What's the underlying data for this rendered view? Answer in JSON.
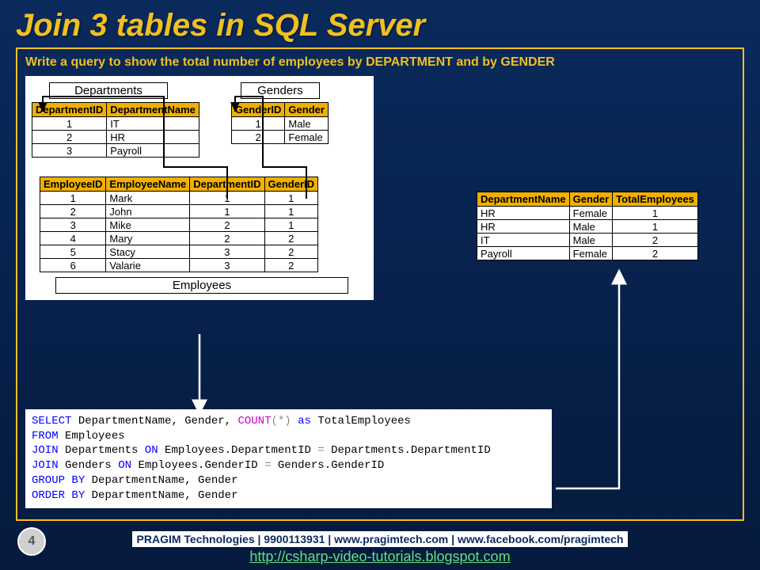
{
  "title": "Join 3 tables in SQL Server",
  "subtitle": "Write a query to show the total number of employees by DEPARTMENT and by GENDER",
  "tables": {
    "departments": {
      "label": "Departments",
      "cols": [
        "DepartmentID",
        "DepartmentName"
      ],
      "rows": [
        [
          "1",
          "IT"
        ],
        [
          "2",
          "HR"
        ],
        [
          "3",
          "Payroll"
        ]
      ]
    },
    "genders": {
      "label": "Genders",
      "cols": [
        "GenderID",
        "Gender"
      ],
      "rows": [
        [
          "1",
          "Male"
        ],
        [
          "2",
          "Female"
        ]
      ]
    },
    "employees": {
      "label": "Employees",
      "cols": [
        "EmployeeID",
        "EmployeeName",
        "DepartmentID",
        "GenderID"
      ],
      "rows": [
        [
          "1",
          "Mark",
          "1",
          "1"
        ],
        [
          "2",
          "John",
          "1",
          "1"
        ],
        [
          "3",
          "Mike",
          "2",
          "1"
        ],
        [
          "4",
          "Mary",
          "2",
          "2"
        ],
        [
          "5",
          "Stacy",
          "3",
          "2"
        ],
        [
          "6",
          "Valarie",
          "3",
          "2"
        ]
      ]
    },
    "result": {
      "cols": [
        "DepartmentName",
        "Gender",
        "TotalEmployees"
      ],
      "rows": [
        [
          "HR",
          "Female",
          "1"
        ],
        [
          "HR",
          "Male",
          "1"
        ],
        [
          "IT",
          "Male",
          "2"
        ],
        [
          "Payroll",
          "Female",
          "2"
        ]
      ]
    }
  },
  "sql": {
    "l1a": "SELECT",
    "l1b": " DepartmentName, Gender, ",
    "l1c": "COUNT",
    "l1d": "(*)",
    "l1e": " as",
    "l1f": " TotalEmployees",
    "l2a": "FROM",
    "l2b": " Employees",
    "l3a": "JOIN",
    "l3b": " Departments ",
    "l3c": "ON",
    "l3d": " Employees.DepartmentID ",
    "l3e": "=",
    "l3f": " Departments.DepartmentID",
    "l4a": "JOIN",
    "l4b": " Genders ",
    "l4c": "ON",
    "l4d": " Employees.GenderID ",
    "l4e": "=",
    "l4f": " Genders.GenderID",
    "l5a": "GROUP",
    "l5b": " BY",
    "l5c": " DepartmentName, Gender",
    "l6a": "ORDER",
    "l6b": " BY",
    "l6c": " DepartmentName, Gender"
  },
  "footer": {
    "bar": "PRAGIM Technologies | 9900113931 | www.pragimtech.com | www.facebook.com/pragimtech",
    "link": "http://csharp-video-tutorials.blogspot.com"
  },
  "page": "4"
}
